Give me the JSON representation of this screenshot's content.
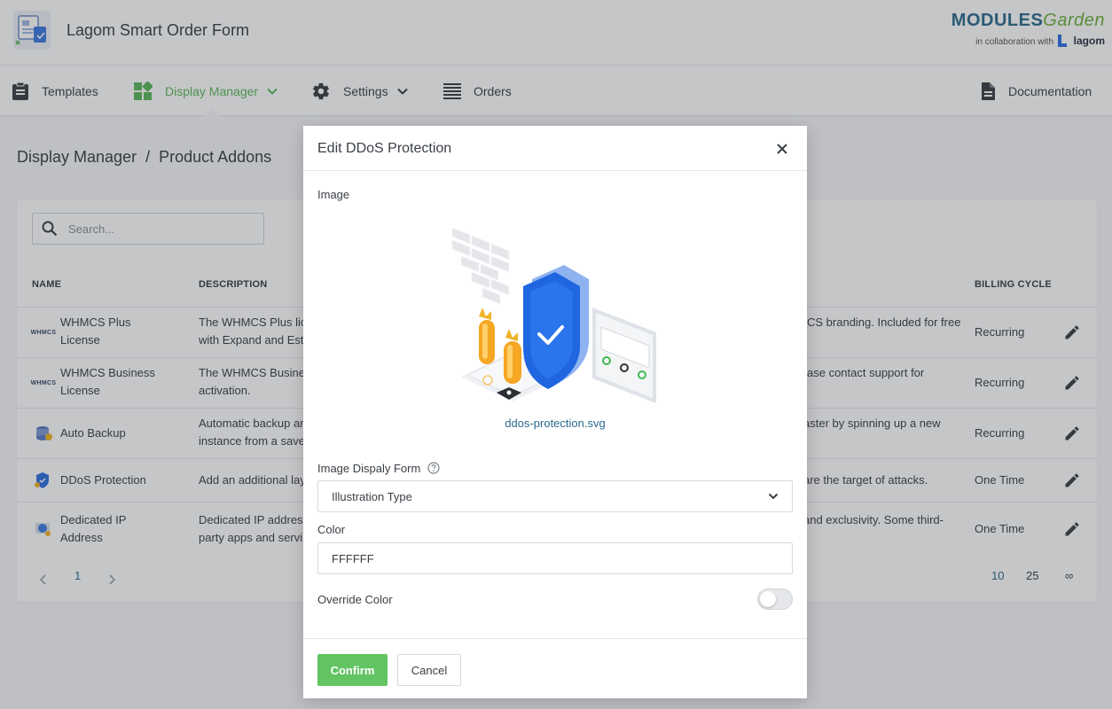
{
  "header": {
    "app_title": "Lagom Smart Order Form",
    "brand": {
      "part1": "MODULES",
      "part2": "Garden",
      "collab": "in collaboration with",
      "partner": "lagom"
    }
  },
  "nav": {
    "items": [
      {
        "label": "Templates",
        "icon": "clipboard-icon"
      },
      {
        "label": "Display Manager",
        "icon": "dashboard-icon",
        "active": true,
        "dropdown": true
      },
      {
        "label": "Settings",
        "icon": "gear-icon",
        "dropdown": true
      },
      {
        "label": "Orders",
        "icon": "list-icon"
      }
    ],
    "right": {
      "label": "Documentation",
      "icon": "document-icon"
    }
  },
  "breadcrumb": {
    "parent": "Display Manager",
    "separator": "/",
    "current": "Product Addons"
  },
  "table": {
    "search_placeholder": "Search...",
    "columns": {
      "name": "NAME",
      "description": "DESCRIPTION",
      "billing": "BILLING CYCLE"
    },
    "rows": [
      {
        "name1": "WHMCS Plus",
        "name2": "License",
        "icon": "whmcs-logo-icon",
        "icon_text": "WHMCS",
        "desc_l1": "The WHMCS Plus lic",
        "desc_l2": "with Expand and Est",
        "desc_r1": "CS branding. Included for free",
        "desc_r2": "",
        "billing": "Recurring"
      },
      {
        "name1": "WHMCS Business",
        "name2": "License",
        "icon": "whmcs-logo-icon",
        "icon_text": "WHMCS",
        "desc_l1": "The WHMCS Busines",
        "desc_l2": "activation.",
        "desc_r1": "ase contact support for",
        "desc_r2": "",
        "billing": "Recurring"
      },
      {
        "name1": "Auto Backup",
        "name2": "",
        "icon": "backup-icon",
        "desc_l1": "Automatic backup ar",
        "desc_l2": "instance from a save",
        "desc_r1": "aster by spinning up a new",
        "desc_r2": "",
        "billing": "Recurring"
      },
      {
        "name1": "DDoS Protection",
        "name2": "",
        "icon": "shield-icon",
        "desc_l1": "Add an additional lay",
        "desc_l2": "",
        "desc_r1": "are the target of attacks.",
        "desc_r2": "",
        "billing": "One Time"
      },
      {
        "name1": "Dedicated IP",
        "name2": "Address",
        "icon": "ip-address-icon",
        "desc_l1": "Dedicated IP address",
        "desc_l2": "party apps and servi",
        "desc_r1": "and exclusivity. Some third-",
        "desc_r2": "",
        "billing": "One Time"
      }
    ],
    "pagination": {
      "page": "1",
      "sizes": [
        "10",
        "25",
        "∞"
      ]
    }
  },
  "modal": {
    "title": "Edit DDoS Protection",
    "image_label": "Image",
    "file_name": "ddos-protection.svg",
    "display_form_label": "Image Dispaly Form",
    "display_form_value": "Illustration Type",
    "color_label": "Color",
    "color_value": "FFFFFF",
    "override_label": "Override Color",
    "override_on": false,
    "confirm_label": "Confirm",
    "cancel_label": "Cancel"
  },
  "colors": {
    "accent": "#5cb85c",
    "link": "#2c6b8e",
    "confirm": "#62c462",
    "shield": "#1f66e0"
  }
}
